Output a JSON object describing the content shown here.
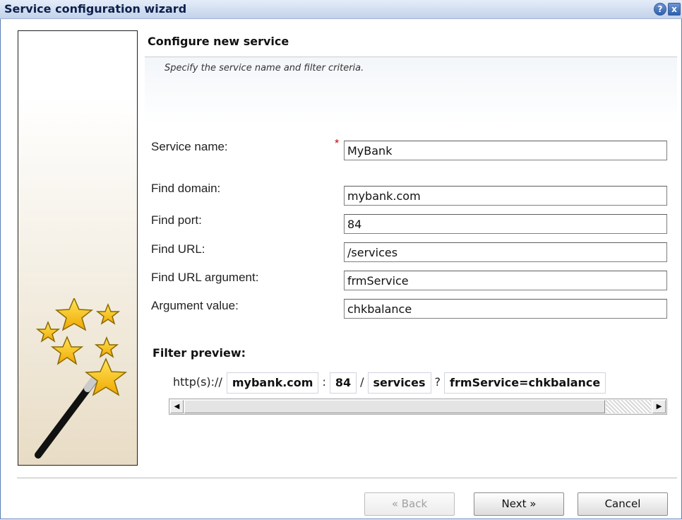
{
  "window": {
    "title": "Service configuration wizard",
    "help_glyph": "?",
    "close_glyph": "x",
    "accent": "#2e5fad"
  },
  "section": {
    "title": "Configure new service",
    "description": "Specify the service name and filter criteria."
  },
  "form": {
    "required_marker": "*",
    "fields": [
      {
        "label": "Service name:",
        "value": "MyBank",
        "required": true
      },
      {
        "label": "Find domain:",
        "value": "mybank.com"
      },
      {
        "label": "Find port:",
        "value": "84"
      },
      {
        "label": "Find URL:",
        "value": "/services"
      },
      {
        "label": "Find URL argument:",
        "value": "frmService"
      },
      {
        "label": "Argument value:",
        "value": "chkbalance"
      }
    ]
  },
  "filter_preview": {
    "title": "Filter preview:",
    "protocol": "http(s)://",
    "domain": "mybank.com",
    "port_sep": ":",
    "port": "84",
    "path_sep": "/",
    "path": "services",
    "query_sep": "?",
    "query": "frmService=chkbalance"
  },
  "scrollbar": {
    "left_arrow": "◀",
    "right_arrow": "▶"
  },
  "buttons": {
    "back": "« Back",
    "next": "Next »",
    "cancel": "Cancel"
  },
  "icons": {
    "side_image": "magic-wand-stars-icon"
  }
}
